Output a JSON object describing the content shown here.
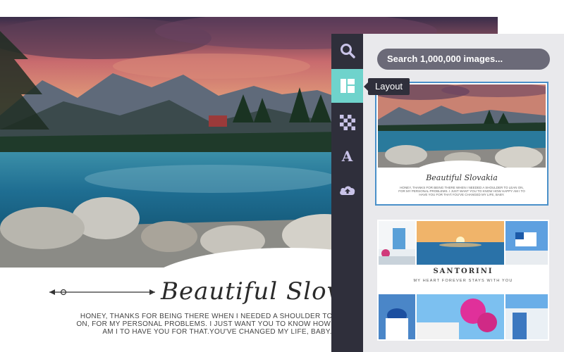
{
  "canvas": {
    "title": "Beautiful Slovakia",
    "body": "HONEY, THANKS FOR BEING THERE WHEN I NEEDED A SHOULDER TO LEAN ON, FOR MY PERSONAL PROBLEMS. I JUST WANT YOU TO KNOW HOW HAPPY AM I TO HAVE YOU FOR THAT.YOU'VE CHANGED MY LIFE, BABY."
  },
  "toolbar": {
    "tools": [
      {
        "icon": "search-icon"
      },
      {
        "icon": "layout-icon",
        "active": true
      },
      {
        "icon": "checkerboard-icon"
      },
      {
        "icon": "text-icon",
        "glyph": "A"
      },
      {
        "icon": "cloud-upload-icon"
      }
    ]
  },
  "tooltip": {
    "label": "Layout"
  },
  "panel": {
    "search_placeholder": "Search 1,000,000 images...",
    "layouts": [
      {
        "title": "Beautiful Slovakia",
        "body": "HONEY, THANKS FOR BEING THERE WHEN I NEEDED A SHOULDER TO LEAN ON, FOR MY PERSONAL PROBLEMS. I JUST WANT YOU TO KNOW HOW HAPPY AM I TO HAVE YOU FOR THAT.YOU'VE CHANGED MY LIFE, BABY.",
        "selected": true
      },
      {
        "title": "SANTORINI",
        "subtitle": "MY HEART FOREVER STAYS WITH YOU",
        "selected": false
      }
    ]
  },
  "colors": {
    "toolbar_bg": "#2f2f3b",
    "active_tool": "#6fd3cc",
    "panel_bg": "#e9e9ec",
    "search_bg": "#6b6a78",
    "selection_border": "#4a90c9",
    "icon_tint": "#c9c3e8"
  }
}
